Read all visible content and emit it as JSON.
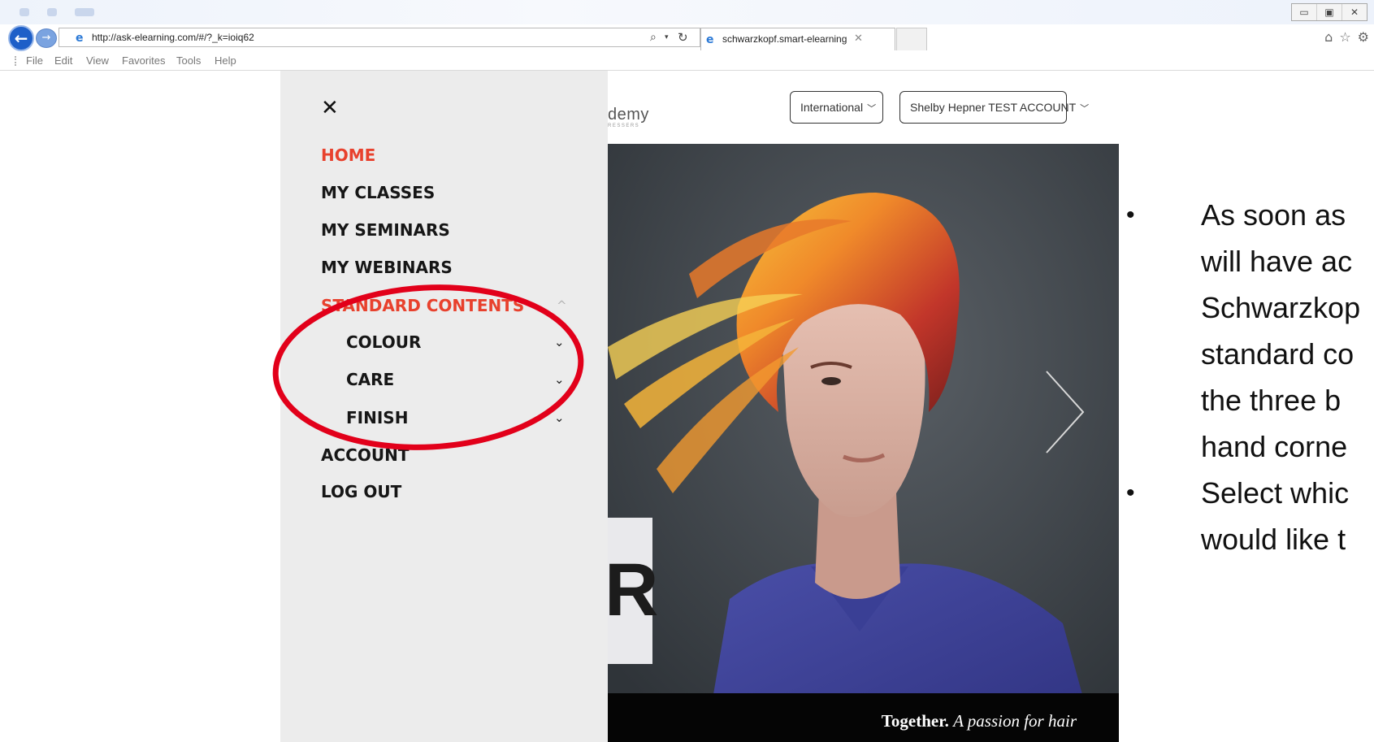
{
  "browser": {
    "url": "http://ask-elearning.com/#/?_k=ioiq62",
    "url_domain": "ask-elearning.com",
    "tab_title": "schwarzkopf.smart-elearning",
    "window_controls": [
      "▭",
      "▣",
      "✕"
    ],
    "menu": [
      "File",
      "Edit",
      "View",
      "Favorites",
      "Tools",
      "Help"
    ],
    "toolbar_icons": [
      "home-icon",
      "star-icon",
      "gear-icon"
    ]
  },
  "header": {
    "logo_text": "demy",
    "logo_sub": "RESSERS",
    "region_label": "International",
    "account_label": "Shelby Hepner TEST ACCOUNT"
  },
  "side_menu": {
    "close_glyph": "✕",
    "items": [
      {
        "label": "HOME",
        "active": true
      },
      {
        "label": "MY CLASSES"
      },
      {
        "label": "MY SEMINARS"
      },
      {
        "label": "MY WEBINARS"
      },
      {
        "label": "STANDARD CONTENTS",
        "active": true,
        "expanded": true
      },
      {
        "label": "COLOUR",
        "sub": true
      },
      {
        "label": "CARE",
        "sub": true
      },
      {
        "label": "FINISH",
        "sub": true
      },
      {
        "label": "ACCOUNT"
      },
      {
        "label": "LOG OUT"
      }
    ],
    "chevron_down": "⌄",
    "chevron_up": "^"
  },
  "hero": {
    "caption_bold": "Together.",
    "caption_italic": "A passion for hair",
    "overlay_letter": "R"
  },
  "slide": {
    "bullets": [
      {
        "lines": [
          "As soon as",
          "will have ac",
          "Schwarzkop",
          "standard co",
          "the three b",
          "hand corne"
        ]
      },
      {
        "lines": [
          "Select whic",
          "would like t"
        ]
      }
    ]
  },
  "colors": {
    "accent_red": "#e8412d",
    "annotation_red": "#e2001a",
    "panel_bg": "#ececec"
  }
}
